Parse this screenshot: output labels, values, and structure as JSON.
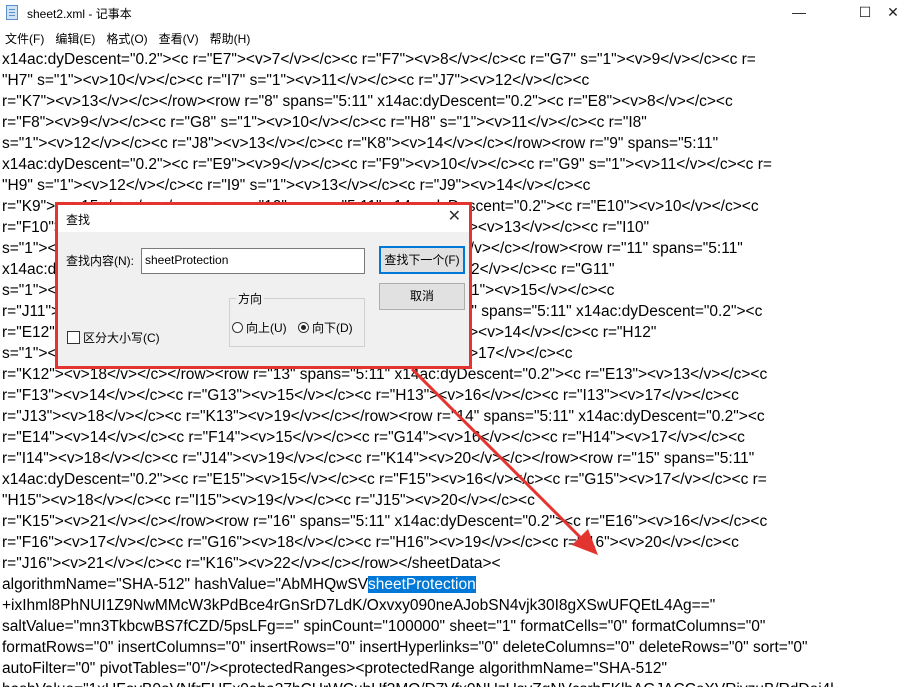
{
  "window": {
    "title": "sheet2.xml - 记事本",
    "minimize_glyph": "—",
    "maximize_glyph": "☐",
    "close_glyph": "✕"
  },
  "menu": [
    "文件(F)",
    "编辑(E)",
    "格式(O)",
    "查看(V)",
    "帮助(H)"
  ],
  "editor_lines": [
    "x14ac:dyDescent=\"0.2\"><c r=\"E7\"><v>7</v></c><c r=\"F7\"><v>8</v></c><c r=\"G7\" s=\"1\"><v>9</v></c><c r=",
    "\"H7\" s=\"1\"><v>10</v></c><c r=\"I7\" s=\"1\"><v>11</v></c><c r=\"J7\"><v>12</v></c><c",
    "r=\"K7\"><v>13</v></c></row><row r=\"8\" spans=\"5:11\" x14ac:dyDescent=\"0.2\"><c r=\"E8\"><v>8</v></c><c",
    "r=\"F8\"><v>9</v></c><c r=\"G8\" s=\"1\"><v>10</v></c><c r=\"H8\" s=\"1\"><v>11</v></c><c r=\"I8\"",
    "s=\"1\"><v>12</v></c><c r=\"J8\"><v>13</v></c><c r=\"K8\"><v>14</v></c></row><row r=\"9\" spans=\"5:11\"",
    "x14ac:dyDescent=\"0.2\"><c r=\"E9\"><v>9</v></c><c r=\"F9\"><v>10</v></c><c r=\"G9\" s=\"1\"><v>11</v></c><c r=",
    "\"H9\" s=\"1\"><v>12</v></c><c r=\"I9\" s=\"1\"><v>13</v></c><c r=\"J9\"><v>14</v></c><c",
    "r=\"K9\"><v>15</v></c></row><row r=\"10\" spans=\"5:11\" x14ac:dyDescent=\"0.2\"><c r=\"E10\"><v>10</v></c><c",
    "r=\"F10\"><v>11</v></c><c r=\"G10\"><v>12</v></c><c r=\"H10\" s=\"2\"><v>13</v></c><c r=\"I10\"",
    "s=\"1\"><v>14</v></c><c r=\"J10\"><v>15</v></c><c r=\"K10\"><v>16</v></c></row><row r=\"11\" spans=\"5:11\"",
    "x14ac:dyDescent=\"0.2\"><c r=\"E11\"><v>11</v></c><c r=\"F11\"><v>12</v></c><c r=\"G11\"",
    "s=\"1\"><v>13</v></c><c r=\"H11\" s=\"1\"><v>14</v></c><c r=\"I11\" s=\"1\"><v>15</v></c><c",
    "r=\"J11\"><v>16</v></c><c r=\"K11\"><v>17</v></c></row><row r=\"12\" spans=\"5:11\" x14ac:dyDescent=\"0.2\"><c",
    "r=\"E12\"><v>12</v></c><c r=\"F12\"><v>13</v></c><c r=\"G12\" s=\"1\"><v>14</v></c><c r=\"H12\"",
    "s=\"1\"><v>15</v></c><c r=\"I12\" s=\"1\"><v>16</v></c><c r=\"J12\"><v>17</v></c><c",
    "r=\"K12\"><v>18</v></c></row><row r=\"13\" spans=\"5:11\" x14ac:dyDescent=\"0.2\"><c r=\"E13\"><v>13</v></c><c",
    "r=\"F13\"><v>14</v></c><c r=\"G13\"><v>15</v></c><c r=\"H13\"><v>16</v></c><c r=\"I13\"><v>17</v></c><c",
    "r=\"J13\"><v>18</v></c><c r=\"K13\"><v>19</v></c></row><row r=\"14\" spans=\"5:11\" x14ac:dyDescent=\"0.2\"><c",
    "r=\"E14\"><v>14</v></c><c r=\"F14\"><v>15</v></c><c r=\"G14\"><v>16</v></c><c r=\"H14\"><v>17</v></c><c",
    "r=\"I14\"><v>18</v></c><c r=\"J14\"><v>19</v></c><c r=\"K14\"><v>20</v></c></row><row r=\"15\" spans=\"5:11\"",
    "x14ac:dyDescent=\"0.2\"><c r=\"E15\"><v>15</v></c><c r=\"F15\"><v>16</v></c><c r=\"G15\"><v>17</v></c><c r=",
    "\"H15\"><v>18</v></c><c r=\"I15\"><v>19</v></c><c r=\"J15\"><v>20</v></c><c",
    "r=\"K15\"><v>21</v></c></row><row r=\"16\" spans=\"5:11\" x14ac:dyDescent=\"0.2\"><c r=\"E16\"><v>16</v></c><c",
    "r=\"F16\"><v>17</v></c><c r=\"G16\"><v>18</v></c><c r=\"H16\"><v>19</v></c><c r=\"I16\"><v>20</v></c><c",
    "r=\"J16\"><v>21</v></c><c r=\"K16\"><v>22</v></c></row></sheetData><",
    "algorithmName=\"SHA-512\" hashValue=\"AbMHQwSV",
    "+ixIhml8PhNUI1Z9NwMMcW3kPdBce4rGnSrD7LdK/Oxvxy090neAJobSN4vjk30I8gXSwUFQEtL4Ag==\"",
    "saltValue=\"mn3TkbcwBS7fCZD/5psLFg==\" spinCount=\"100000\" sheet=\"1\" formatCells=\"0\" formatColumns=\"0\"",
    "formatRows=\"0\" insertColumns=\"0\" insertRows=\"0\" insertHyperlinks=\"0\" deleteColumns=\"0\" deleteRows=\"0\" sort=\"0\"",
    "autoFilter=\"0\" pivotTables=\"0\"/><protectedRanges><protectedRange algorithmName=\"SHA-512\"",
    "hashValue=\"1xUFoyB0oVNfrEUEx0aba37hCHrWCubUf3MO/D7Vfx0NUzUsyZqNVcsrhFKlhAGJACCeXVRjyzuB/RdDei4l"
  ],
  "selected_word": "sheetProtection",
  "find_dialog": {
    "title": "查找",
    "close_glyph": "✕",
    "find_label": "查找内容(N):",
    "find_value": "sheetProtection",
    "find_next_label": "查找下一个(F)",
    "cancel_label": "取消",
    "direction_label": "方向",
    "up_label": "向上(U)",
    "down_label": "向下(D)",
    "match_case_label": "区分大小写(C)",
    "direction_selected": "down",
    "match_case_checked": false
  },
  "annotation_color": "#e3342f"
}
